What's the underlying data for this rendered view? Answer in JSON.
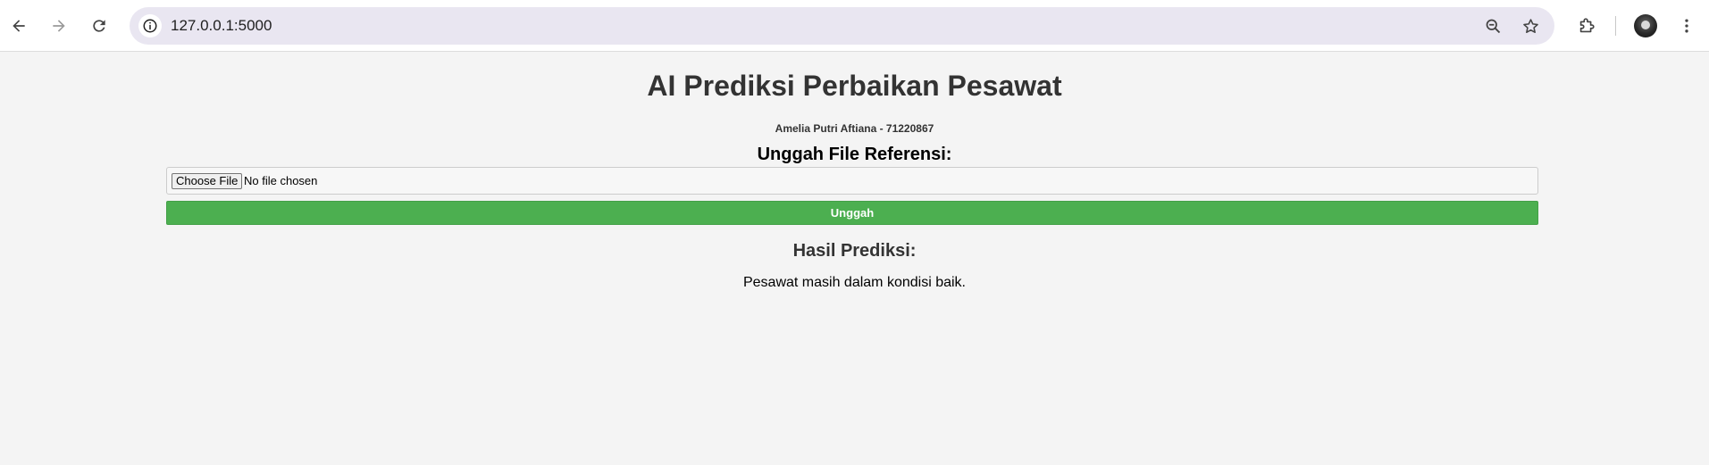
{
  "browser": {
    "url": "127.0.0.1:5000",
    "icons": {
      "back": "arrow-left-icon",
      "forward": "arrow-right-icon",
      "reload": "reload-icon",
      "site_info": "info-icon",
      "zoom": "zoom-out-icon",
      "bookmark": "star-icon",
      "extensions": "puzzle-icon",
      "profile": "avatar",
      "menu": "kebab-menu-icon"
    }
  },
  "page": {
    "title": "AI Prediksi Perbaikan Pesawat",
    "author": "Amelia Putri Aftiana - 71220867",
    "upload_heading": "Unggah File Referensi:",
    "file_input": {
      "button_label": "Choose File",
      "status": "No file chosen"
    },
    "upload_button_label": "Unggah",
    "result_heading": "Hasil Prediksi:",
    "result_text": "Pesawat masih dalam kondisi baik."
  },
  "colors": {
    "page_background": "#f4f4f4",
    "accent_button": "#4caf50",
    "omnibox": "#e9e6f1"
  }
}
